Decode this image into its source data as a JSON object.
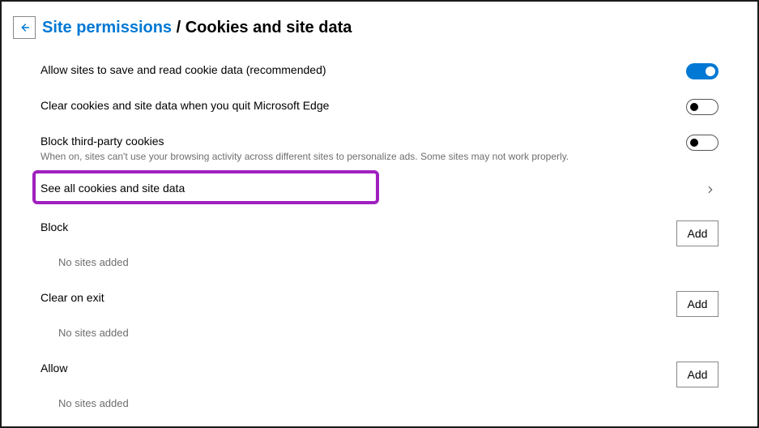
{
  "header": {
    "breadcrumb_link": "Site permissions",
    "breadcrumb_sep": " / ",
    "breadcrumb_current": "Cookies and site data"
  },
  "rows": {
    "allow_cookies": {
      "title": "Allow sites to save and read cookie data (recommended)"
    },
    "clear_on_quit": {
      "title": "Clear cookies and site data when you quit Microsoft Edge"
    },
    "block_third_party": {
      "title": "Block third-party cookies",
      "desc": "When on, sites can't use your browsing activity across different sites to personalize ads. Some sites may not work properly."
    },
    "see_all": {
      "title": "See all cookies and site data"
    },
    "block": {
      "title": "Block",
      "empty": "No sites added",
      "add": "Add"
    },
    "clear_exit": {
      "title": "Clear on exit",
      "empty": "No sites added",
      "add": "Add"
    },
    "allow": {
      "title": "Allow",
      "empty": "No sites added",
      "add": "Add"
    }
  }
}
